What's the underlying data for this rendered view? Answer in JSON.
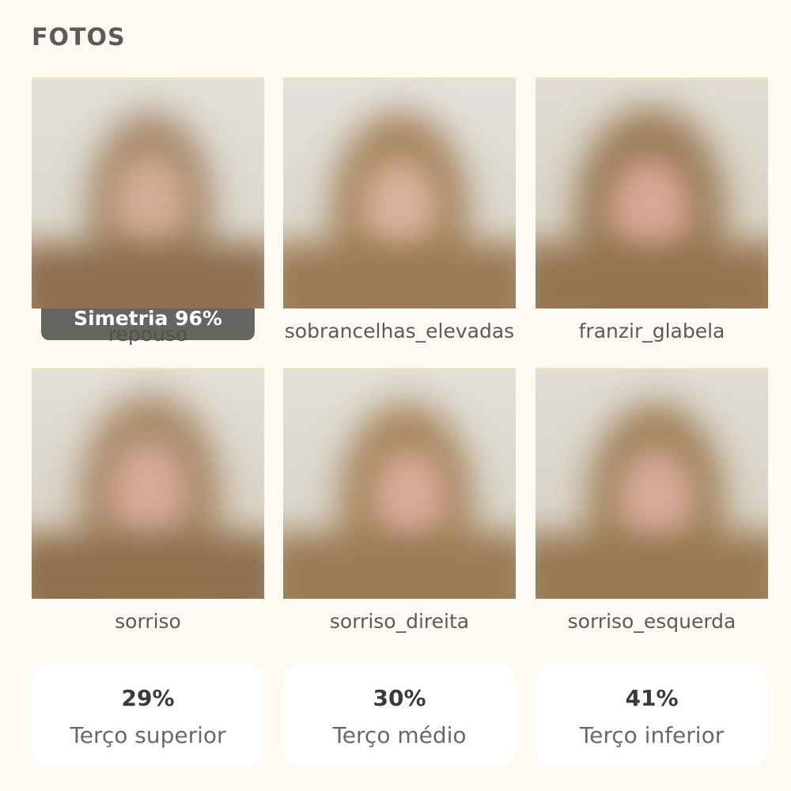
{
  "section": {
    "title": "FOTOS"
  },
  "photos": [
    {
      "label": "repouso",
      "badge": "Simetria 96%"
    },
    {
      "label": "sobrancelhas_elevadas"
    },
    {
      "label": "franzir_glabela"
    },
    {
      "label": "sorriso"
    },
    {
      "label": "sorriso_direita"
    },
    {
      "label": "sorriso_esquerda"
    }
  ],
  "stats": [
    {
      "value": "29%",
      "label": "Terço superior"
    },
    {
      "value": "30%",
      "label": "Terço médio"
    },
    {
      "value": "41%",
      "label": "Terço inferior"
    }
  ],
  "colors": {
    "background": "#fcfaf3",
    "card": "#ffffff",
    "text": "#5e5a57",
    "badge": "#505050",
    "photo_bg": "#dedcd4",
    "hair": "#a88865",
    "skin": "#d6ad98"
  }
}
